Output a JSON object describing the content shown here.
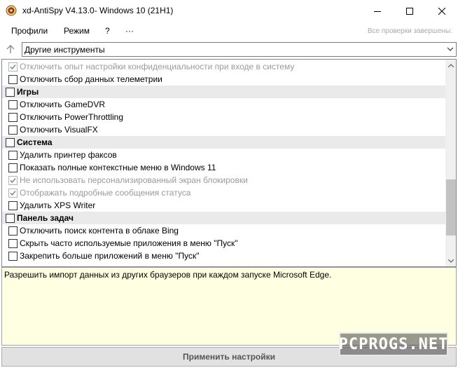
{
  "window": {
    "title": "xd-AntiSpy V4.13.0- Windows 10 (21H1)",
    "icon": "shield-app-icon"
  },
  "menu": {
    "items": [
      {
        "label": "Профили"
      },
      {
        "label": "Режим"
      },
      {
        "label": "?"
      },
      {
        "label": "···"
      }
    ],
    "status": "Все проверки завершены."
  },
  "nav": {
    "combo_value": "Другие инструменты"
  },
  "list": {
    "rows": [
      {
        "kind": "item",
        "label": "Отключить опыт настройки конфиденциальности при входе в систему",
        "checked": true,
        "disabled": true
      },
      {
        "kind": "item",
        "label": "Отключить сбор данных телеметрии",
        "checked": false,
        "disabled": false
      },
      {
        "kind": "group",
        "label": "Игры"
      },
      {
        "kind": "item",
        "label": "Отключить GameDVR",
        "checked": false,
        "disabled": false
      },
      {
        "kind": "item",
        "label": "Отключить PowerThrottling",
        "checked": false,
        "disabled": false
      },
      {
        "kind": "item",
        "label": "Отключить VisualFX",
        "checked": false,
        "disabled": false
      },
      {
        "kind": "group",
        "label": "Система"
      },
      {
        "kind": "item",
        "label": "Удалить принтер факсов",
        "checked": false,
        "disabled": false
      },
      {
        "kind": "item",
        "label": "Показать полные контекстные меню в Windows 11",
        "checked": false,
        "disabled": false
      },
      {
        "kind": "item",
        "label": "Не использовать персонализированный экран блокировки",
        "checked": true,
        "disabled": true
      },
      {
        "kind": "item",
        "label": "Отображать подробные сообщения статуса",
        "checked": true,
        "disabled": true
      },
      {
        "kind": "item",
        "label": "Удалить XPS Writer",
        "checked": false,
        "disabled": false
      },
      {
        "kind": "group",
        "label": "Панель задач"
      },
      {
        "kind": "item",
        "label": "Отключить поиск контента в облаке Bing",
        "checked": false,
        "disabled": false
      },
      {
        "kind": "item",
        "label": "Скрыть часто используемые приложения в меню \"Пуск\"",
        "checked": false,
        "disabled": false
      },
      {
        "kind": "item",
        "label": "Закрепить больше приложений в меню \"Пуск\"",
        "checked": false,
        "disabled": false
      }
    ],
    "scroll_position": 0.85
  },
  "description": "Разрешить импорт данных из других браузеров при каждом запуске Microsoft Edge.",
  "apply_label": "Применить настройки",
  "watermark": "PCPROGS.NET"
}
